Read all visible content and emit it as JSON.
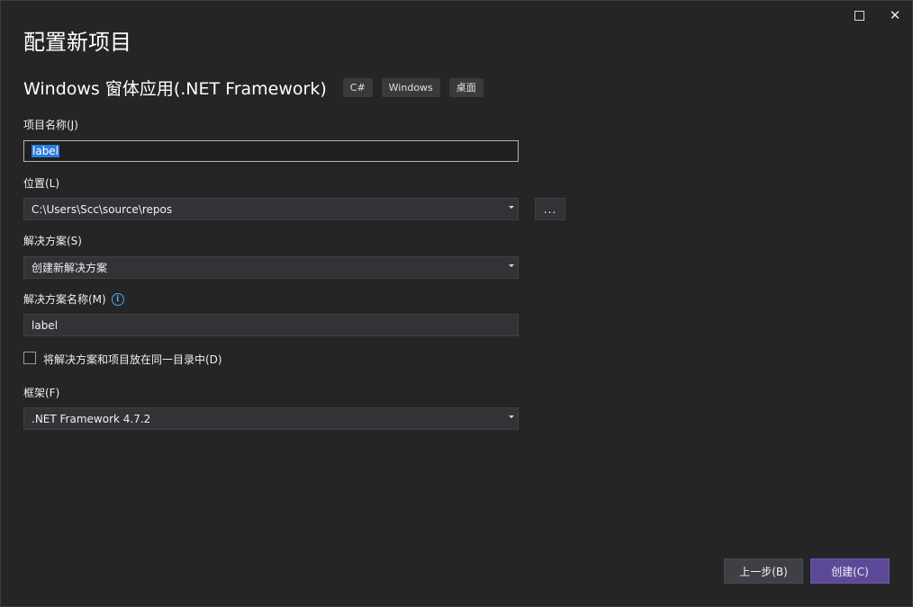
{
  "window": {
    "maximize_label": "",
    "close_label": "✕"
  },
  "header": {
    "title": "配置新项目",
    "template_name": "Windows 窗体应用(.NET Framework)",
    "tags": [
      "C#",
      "Windows",
      "桌面"
    ]
  },
  "form": {
    "project_name": {
      "label": "项目名称(J)",
      "value": "label"
    },
    "location": {
      "label": "位置(L)",
      "value": "C:\\Users\\Scc\\source\\repos",
      "browse_label": "..."
    },
    "solution": {
      "label": "解决方案(S)",
      "value": "创建新解决方案"
    },
    "solution_name": {
      "label": "解决方案名称(M)",
      "info_icon": "info-icon",
      "value": "label"
    },
    "same_directory": {
      "label": "将解决方案和项目放在同一目录中(D)",
      "checked": false
    },
    "framework": {
      "label": "框架(F)",
      "value": ".NET Framework 4.7.2"
    }
  },
  "footer": {
    "back_label": "上一步(B)",
    "create_label": "创建(C)"
  },
  "colors": {
    "background": "#252526",
    "input_background": "#333337",
    "selection": "#2b7bdc",
    "primary_button": "#5c4a99",
    "secondary_button": "#3f3f46",
    "info_icon": "#4fa3ff"
  }
}
